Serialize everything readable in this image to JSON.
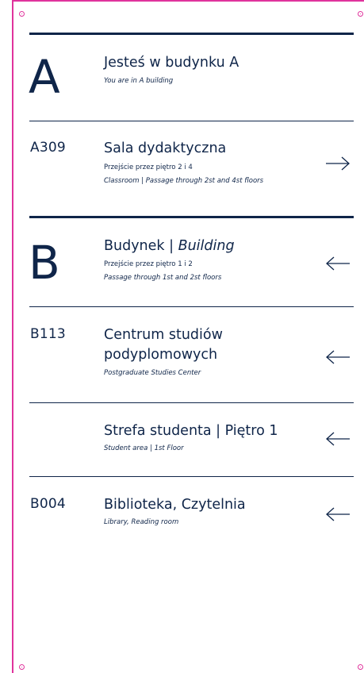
{
  "accent_color": "#0f2549",
  "guide_color": "#e0339c",
  "sections": {
    "a": {
      "letter": "A",
      "title": "Jesteś w budynku A",
      "subtitle_en": "You are in A building"
    },
    "a309": {
      "code": "A309",
      "title": "Sala dydaktyczna",
      "subtitle_pl": "Przejście przez piętro 2 i 4",
      "subtitle_en": "Classroom | Passage through 2st and 4st floors",
      "arrow": "arrow-right"
    },
    "b": {
      "letter": "B",
      "title_pl": "Budynek | ",
      "title_en": "Building",
      "subtitle_pl": "Przejście przez piętro 1 i 2",
      "subtitle_en": "Passage through 1st and 2st floors",
      "arrow": "arrow-left"
    },
    "b113": {
      "code": "B113",
      "title_line1": "Centrum studiów",
      "title_line2": "podyplomowych",
      "subtitle_en": "Postgraduate Studies Center",
      "arrow": "arrow-left"
    },
    "student": {
      "title": "Strefa studenta | Piętro 1",
      "subtitle_en": "Student area | 1st Floor",
      "arrow": "arrow-left"
    },
    "b004": {
      "code": "B004",
      "title": "Biblioteka, Czytelnia",
      "subtitle_en": "Library, Reading room",
      "arrow": "arrow-left"
    }
  }
}
